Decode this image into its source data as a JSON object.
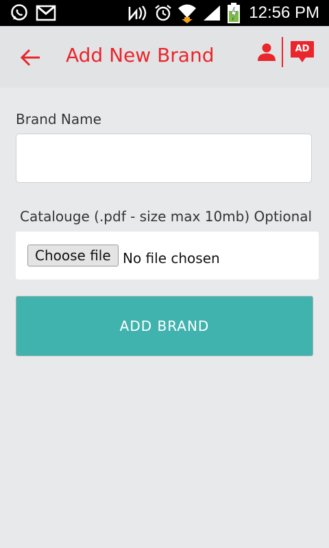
{
  "status_bar": {
    "time": "12:56 PM",
    "left_icons": [
      "whatsapp-icon",
      "gmail-icon"
    ],
    "right_icons": [
      "nfc-icon",
      "alarm-icon",
      "wifi-icon",
      "signal-icon",
      "battery-charging-icon"
    ]
  },
  "app_bar": {
    "title": "Add New Brand",
    "ad_badge": "AD",
    "accent_color": "#e8262b"
  },
  "form": {
    "brand_name_label": "Brand Name",
    "brand_name_value": "",
    "catalogue_label": "Catalouge (.pdf - size max 10mb) Optional",
    "choose_file_label": "Choose file",
    "file_status": "No file chosen",
    "submit_label": "ADD BRAND",
    "submit_color": "#41b3ae"
  }
}
